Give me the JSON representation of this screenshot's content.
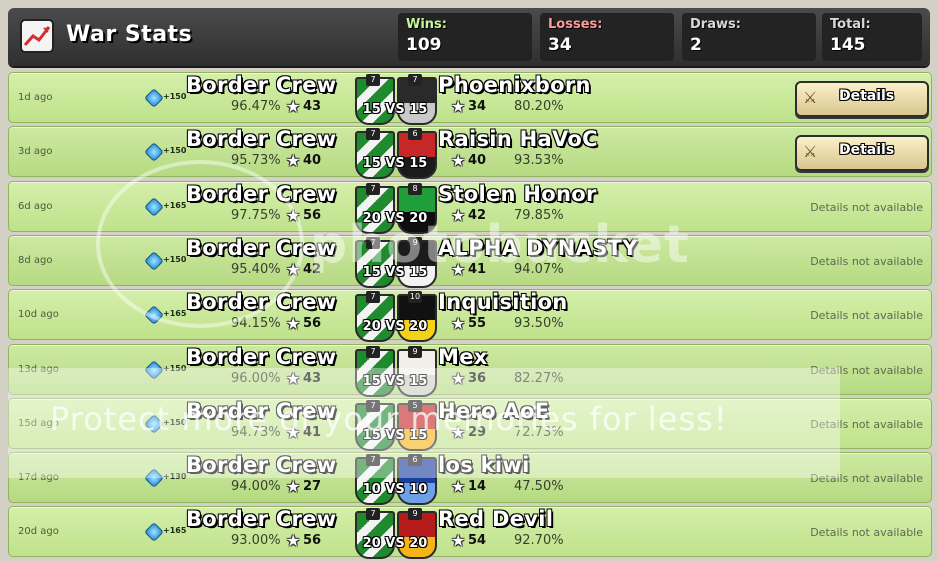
{
  "header": {
    "title": "War Stats",
    "stats": [
      {
        "label": "Wins:",
        "value": "109",
        "color": "#c7f59a"
      },
      {
        "label": "Losses:",
        "value": "34",
        "color": "#ff9a9a"
      },
      {
        "label": "Draws:",
        "value": "2",
        "color": "#d8d8d8"
      },
      {
        "label": "Total:",
        "value": "145",
        "color": "#d8d8d8"
      }
    ]
  },
  "details_label": "Details",
  "na_label": "Details not available",
  "vs_sep": "VS",
  "rows": [
    {
      "ago": "1d ago",
      "xp": "+150",
      "clan": "Border Crew",
      "pct": "96.47%",
      "stars": "43",
      "lvl": "7",
      "size": "15",
      "opp_lvl": "7",
      "opp": "Phoenixborn",
      "opp_stars": "34",
      "opp_pct": "80.20%",
      "details": true,
      "opp_flag": "#2a2a2a",
      "opp_flag2": "#c9c9c9"
    },
    {
      "ago": "3d ago",
      "xp": "+150",
      "clan": "Border Crew",
      "pct": "95.73%",
      "stars": "40",
      "lvl": "7",
      "size": "15",
      "opp_lvl": "6",
      "opp": "Raisin HaVoC",
      "opp_stars": "40",
      "opp_pct": "93.53%",
      "details": true,
      "opp_flag": "#c62828",
      "opp_flag2": "#1b1b1b"
    },
    {
      "ago": "6d ago",
      "xp": "+165",
      "clan": "Border Crew",
      "pct": "97.75%",
      "stars": "56",
      "lvl": "7",
      "size": "20",
      "opp_lvl": "8",
      "opp": "Stolen Honor",
      "opp_stars": "42",
      "opp_pct": "79.85%",
      "details": false,
      "opp_flag": "#1f9e3a",
      "opp_flag2": "#0e0e0e"
    },
    {
      "ago": "8d ago",
      "xp": "+150",
      "clan": "Border Crew",
      "pct": "95.40%",
      "stars": "42",
      "lvl": "7",
      "size": "15",
      "opp_lvl": "9",
      "opp": "ALPHA DYNASTY",
      "opp_stars": "41",
      "opp_pct": "94.07%",
      "details": false,
      "opp_flag": "#1b1b1b",
      "opp_flag2": "#f2f2f2"
    },
    {
      "ago": "10d ago",
      "xp": "+165",
      "clan": "Border Crew",
      "pct": "94.15%",
      "stars": "56",
      "lvl": "7",
      "size": "20",
      "opp_lvl": "10",
      "opp": "Inquisition",
      "opp_stars": "55",
      "opp_pct": "93.50%",
      "details": false,
      "opp_flag": "#111111",
      "opp_flag2": "#f5d21a"
    },
    {
      "ago": "13d ago",
      "xp": "+150",
      "clan": "Border Crew",
      "pct": "96.00%",
      "stars": "43",
      "lvl": "7",
      "size": "15",
      "opp_lvl": "9",
      "opp": "Mex",
      "opp_stars": "36",
      "opp_pct": "82.27%",
      "details": false,
      "opp_flag": "#f0efe8",
      "opp_flag2": "#cfcfc5"
    },
    {
      "ago": "15d ago",
      "xp": "+150",
      "clan": "Border Crew",
      "pct": "94.73%",
      "stars": "41",
      "lvl": "7",
      "size": "15",
      "opp_lvl": "5",
      "opp": "Hero AoE",
      "opp_stars": "29",
      "opp_pct": "72.73%",
      "details": false,
      "opp_flag": "#c62828",
      "opp_flag2": "#f5b51a"
    },
    {
      "ago": "17d ago",
      "xp": "+130",
      "clan": "Border Crew",
      "pct": "94.00%",
      "stars": "27",
      "lvl": "7",
      "size": "10",
      "opp_lvl": "6",
      "opp": "los kiwi",
      "opp_stars": "14",
      "opp_pct": "47.50%",
      "details": false,
      "opp_flag": "#1a3f9e",
      "opp_flag2": "#6ea0e8"
    },
    {
      "ago": "20d ago",
      "xp": "+165",
      "clan": "Border Crew",
      "pct": "93.00%",
      "stars": "56",
      "lvl": "7",
      "size": "20",
      "opp_lvl": "9",
      "opp": "Red Devil",
      "opp_stars": "54",
      "opp_pct": "92.70%",
      "details": false,
      "opp_flag": "#b71c1c",
      "opp_flag2": "#f5b51a"
    }
  ],
  "watermark": {
    "brand": "photobucket",
    "text": "Protect more of your memories for less!"
  }
}
